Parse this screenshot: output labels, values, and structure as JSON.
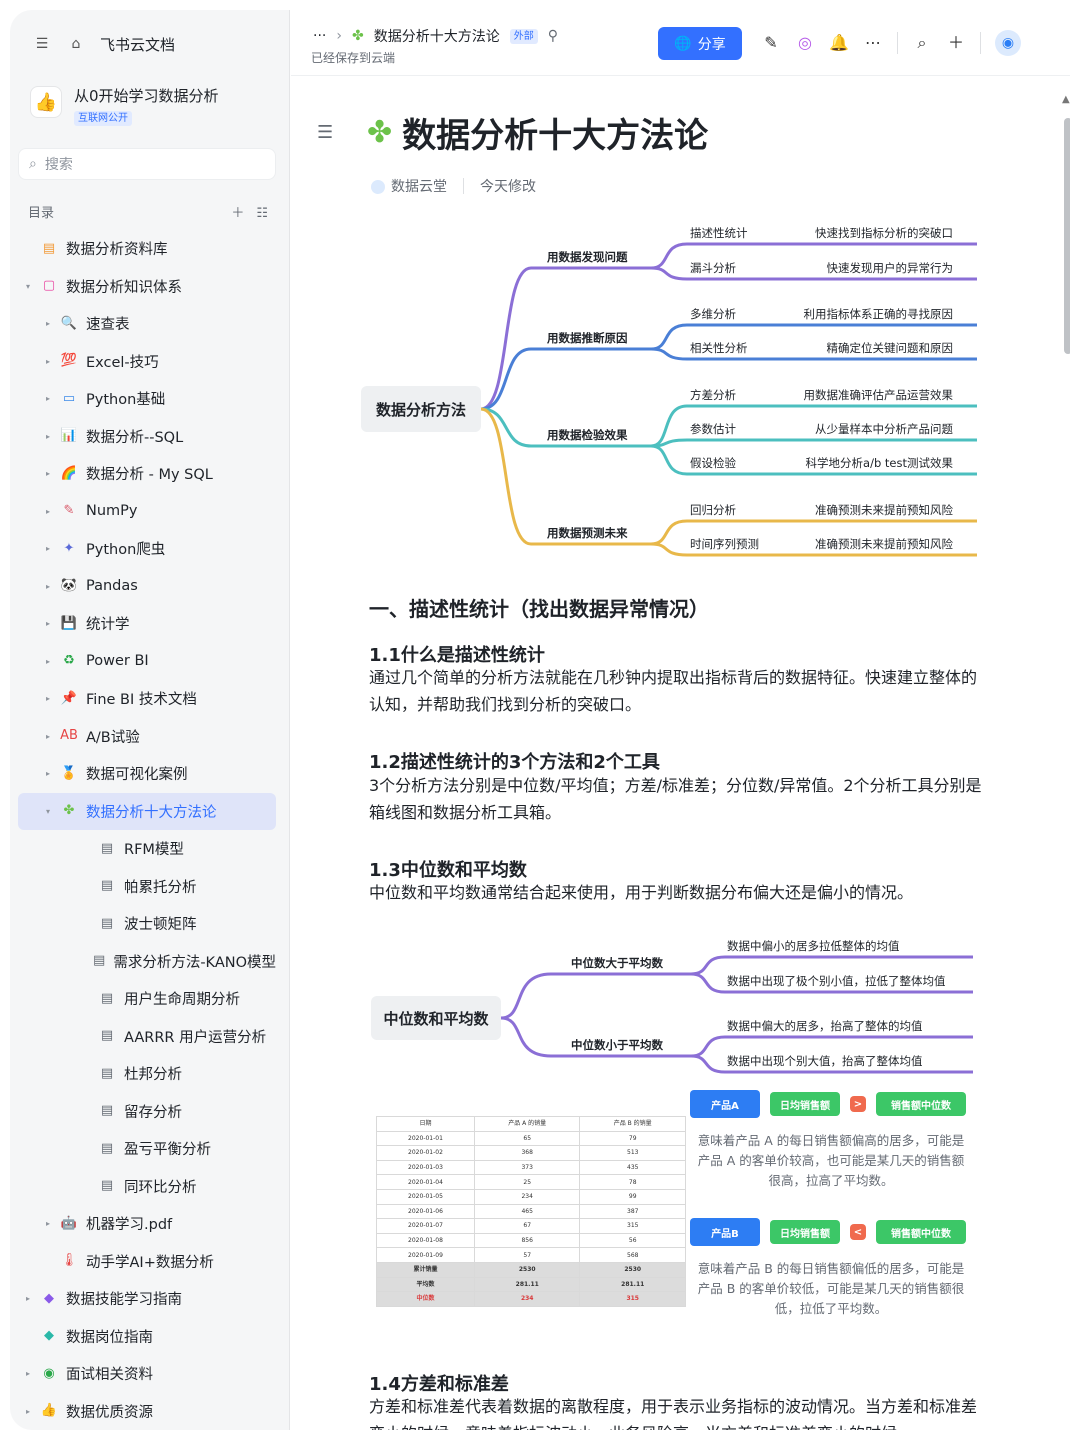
{
  "sidebar": {
    "home_label": "飞书云文档",
    "workspace": {
      "title": "从0开始学习数据分析",
      "badge": "互联网公开"
    },
    "search_placeholder": "搜索",
    "toc_label": "目录",
    "items": [
      {
        "label": "数据分析资料库",
        "level": 0,
        "caret": "",
        "icon": "▤",
        "color": "#f29a38"
      },
      {
        "label": "数据分析知识体系",
        "level": 0,
        "caret": "▾",
        "icon": "▢",
        "color": "#e94aa3"
      },
      {
        "label": "速查表",
        "level": 1,
        "caret": "▸",
        "icon": "🔍",
        "color": "#3370ff"
      },
      {
        "label": "Excel-技巧",
        "level": 1,
        "caret": "▸",
        "icon": "💯",
        "color": "#e64545"
      },
      {
        "label": "Python基础",
        "level": 1,
        "caret": "▸",
        "icon": "▭",
        "color": "#3d8ae8"
      },
      {
        "label": "数据分析--SQL",
        "level": 1,
        "caret": "▸",
        "icon": "📊",
        "color": "#3370ff"
      },
      {
        "label": "数据分析 - My SQL",
        "level": 1,
        "caret": "▸",
        "icon": "🌈",
        "color": "#e88a2a"
      },
      {
        "label": "NumPy",
        "level": 1,
        "caret": "▸",
        "icon": "✎",
        "color": "#d85a6a"
      },
      {
        "label": "Python爬虫",
        "level": 1,
        "caret": "▸",
        "icon": "✦",
        "color": "#5a6ad8"
      },
      {
        "label": "Pandas",
        "level": 1,
        "caret": "▸",
        "icon": "🐼",
        "color": "#333"
      },
      {
        "label": "统计学",
        "level": 1,
        "caret": "▸",
        "icon": "💾",
        "color": "#7a3ad8"
      },
      {
        "label": "Power BI",
        "level": 1,
        "caret": "▸",
        "icon": "♻",
        "color": "#2aa84a"
      },
      {
        "label": "Fine BI 技术文档",
        "level": 1,
        "caret": "▸",
        "icon": "📌",
        "color": "#e64545"
      },
      {
        "label": "A/B试验",
        "level": 1,
        "caret": "▸",
        "icon": "AB",
        "color": "#e64545"
      },
      {
        "label": "数据可视化案例",
        "level": 1,
        "caret": "▸",
        "icon": "🏅",
        "color": "#e8a02a"
      },
      {
        "label": "数据分析十大方法论",
        "level": 1,
        "caret": "▾",
        "icon": "✤",
        "color": "#6cc24a",
        "active": true
      },
      {
        "label": "RFM模型",
        "level": 2,
        "caret": "",
        "icon": "▤",
        "color": "#646a73"
      },
      {
        "label": "帕累托分析",
        "level": 2,
        "caret": "",
        "icon": "▤",
        "color": "#646a73"
      },
      {
        "label": "波士顿矩阵",
        "level": 2,
        "caret": "",
        "icon": "▤",
        "color": "#646a73"
      },
      {
        "label": "需求分析方法-KANO模型",
        "level": 2,
        "caret": "",
        "icon": "▤",
        "color": "#646a73"
      },
      {
        "label": "用户生命周期分析",
        "level": 2,
        "caret": "",
        "icon": "▤",
        "color": "#646a73"
      },
      {
        "label": "AARRR 用户运营分析",
        "level": 2,
        "caret": "",
        "icon": "▤",
        "color": "#646a73"
      },
      {
        "label": "杜邦分析",
        "level": 2,
        "caret": "",
        "icon": "▤",
        "color": "#646a73"
      },
      {
        "label": "留存分析",
        "level": 2,
        "caret": "",
        "icon": "▤",
        "color": "#646a73"
      },
      {
        "label": "盈亏平衡分析",
        "level": 2,
        "caret": "",
        "icon": "▤",
        "color": "#646a73"
      },
      {
        "label": "同环比分析",
        "level": 2,
        "caret": "",
        "icon": "▤",
        "color": "#646a73"
      },
      {
        "label": "机器学习.pdf",
        "level": 1,
        "caret": "▸",
        "icon": "🤖",
        "color": "#333"
      },
      {
        "label": "动手学AI+数据分析",
        "level": 1,
        "caret": "",
        "icon": "🌡",
        "color": "#e64545"
      },
      {
        "label": "数据技能学习指南",
        "level": 0,
        "caret": "▸",
        "icon": "◆",
        "color": "#8a5ae8"
      },
      {
        "label": "数据岗位指南",
        "level": 0,
        "caret": "",
        "icon": "◆",
        "color": "#2ab8a8"
      },
      {
        "label": "面试相关资料",
        "level": 0,
        "caret": "▸",
        "icon": "◉",
        "color": "#2aa84a"
      },
      {
        "label": "数据优质资源",
        "level": 0,
        "caret": "▸",
        "icon": "👍",
        "color": "#e8a02a"
      }
    ]
  },
  "topbar": {
    "more": "···",
    "doc_name": "数据分析十大方法论",
    "doc_badge": "外部",
    "saved_text": "已经保存到云端",
    "share_label": "分享"
  },
  "doc": {
    "title": "数据分析十大方法论",
    "author": "数据云堂",
    "modified": "今天修改",
    "mindmap1": {
      "root": "数据分析方法",
      "branches": [
        {
          "label": "用数据发现问题",
          "color": "#8b6fd6",
          "leaves": [
            {
              "name": "描述性统计",
              "desc": "快速找到指标分析的突破口"
            },
            {
              "name": "漏斗分析",
              "desc": "快速发现用户的异常行为"
            }
          ]
        },
        {
          "label": "用数据推断原因",
          "color": "#4a7fd6",
          "leaves": [
            {
              "name": "多维分析",
              "desc": "利用指标体系正确的寻找原因"
            },
            {
              "name": "相关性分析",
              "desc": "精确定位关键问题和原因"
            }
          ]
        },
        {
          "label": "用数据检验效果",
          "color": "#4cbfbf",
          "leaves": [
            {
              "name": "方差分析",
              "desc": "用数据准确评估产品运营效果"
            },
            {
              "name": "参数估计",
              "desc": "从少量样本中分析产品问题"
            },
            {
              "name": "假设检验",
              "desc": "科学地分析a/b test测试效果"
            }
          ]
        },
        {
          "label": "用数据预测未来",
          "color": "#e8b84a",
          "leaves": [
            {
              "name": "回归分析",
              "desc": "准确预测未来提前预知风险"
            },
            {
              "name": "时间序列预测",
              "desc": "准确预测未来提前预知风险"
            }
          ]
        }
      ]
    },
    "h1": "一、描述性统计（找出数据异常情况）",
    "sections": [
      {
        "title": "1.1什么是描述性统计",
        "text": "通过几个简单的分析方法就能在几秒钟内提取出指标背后的数据特征。快速建立整体的认知，并帮助我们找到分析的突破口。"
      },
      {
        "title": "1.2描述性统计的3个方法和2个工具",
        "text": "3个分析方法分别是中位数/平均值；方差/标准差；分位数/异常值。2个分析工具分别是箱线图和数据分析工具箱。"
      },
      {
        "title": "1.3中位数和平均数",
        "text": "中位数和平均数通常结合起来使用，用于判断数据分布偏大还是偏小的情况。"
      },
      {
        "title": "1.4方差和标准差",
        "text": "方差和标准差代表着数据的离散程度，用于表示业务指标的波动情况。当方差和标准差变小的时候，意味着指标波动小，业务风险高，当方差和标准差变小的时候"
      }
    ],
    "mindmap2": {
      "root": "中位数和平均数",
      "branches": [
        {
          "label": "中位数大于平均数",
          "leaves": [
            "数据中偏小的居多拉低整体的均值",
            "数据中出现了极个别小值，拉低了整体均值"
          ]
        },
        {
          "label": "中位数小于平均数",
          "leaves": [
            "数据中偏大的居多，抬高了整体的均值",
            "数据中出现个别大值，抬高了整体均值"
          ]
        }
      ]
    },
    "table": {
      "headers": [
        "日期",
        "产品 A 的销量",
        "产品 B 的销量"
      ],
      "rows": [
        [
          "2020-01-01",
          "65",
          "79"
        ],
        [
          "2020-01-02",
          "368",
          "513"
        ],
        [
          "2020-01-03",
          "373",
          "435"
        ],
        [
          "2020-01-04",
          "25",
          "78"
        ],
        [
          "2020-01-05",
          "234",
          "99"
        ],
        [
          "2020-01-06",
          "465",
          "387"
        ],
        [
          "2020-01-07",
          "67",
          "315"
        ],
        [
          "2020-01-08",
          "856",
          "56"
        ],
        [
          "2020-01-09",
          "57",
          "568"
        ]
      ],
      "footer": [
        [
          "累计销量",
          "2530",
          "2530"
        ],
        [
          "平均数",
          "281.11",
          "281.11"
        ],
        [
          "中位数",
          "234",
          "315"
        ]
      ]
    },
    "compare": {
      "a": {
        "product": "产品A",
        "metric": "日均销售额",
        "op": ">",
        "median": "销售额中位数",
        "note": "意味着产品 A 的每日销售额偏高的居多，可能是产品 A 的客单价较高，也可能是某几天的销售额很高，拉高了平均数。"
      },
      "b": {
        "product": "产品B",
        "metric": "日均销售额",
        "op": "<",
        "median": "销售额中位数",
        "note": "意味着产品 B 的每日销售额偏低的居多，可能是产品 B 的客单价较低，可能是某几天的销售额很低，拉低了平均数。"
      }
    }
  }
}
